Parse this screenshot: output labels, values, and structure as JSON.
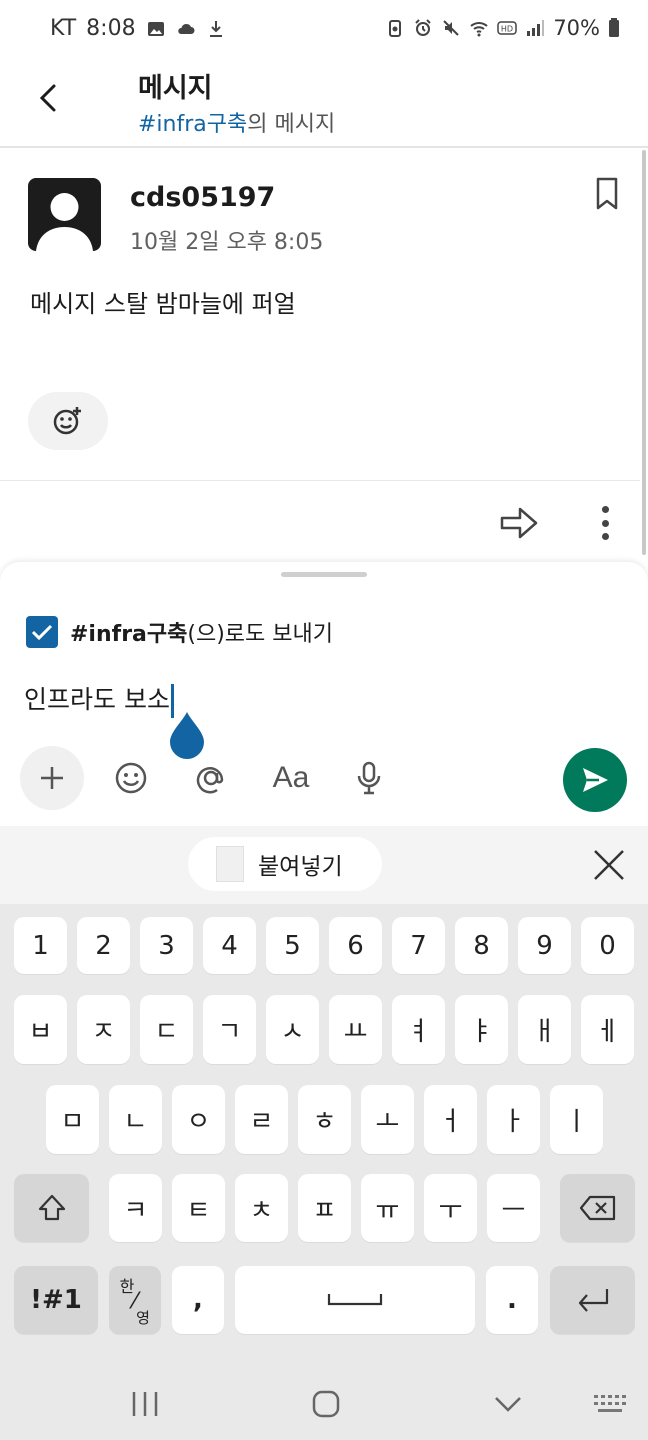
{
  "status_bar": {
    "carrier": "KT",
    "time": "8:08",
    "battery": "70%"
  },
  "header": {
    "title": "메시지",
    "channel": "#infra구축",
    "subtitle_suffix": "의 메시지"
  },
  "message": {
    "author": "cds05197",
    "timestamp": "10월 2일 오후 8:05",
    "text": "메시지 스탈 밤마늘에 퍼얼"
  },
  "composer": {
    "also_send_channel": "#infra구축",
    "also_send_suffix": "(으)로도 보내기",
    "also_send_checked": true,
    "draft_text": "인프라도 보소",
    "format_label": "Aa"
  },
  "keyboard": {
    "paste_label": "붙여넣기",
    "row_numbers": [
      "1",
      "2",
      "3",
      "4",
      "5",
      "6",
      "7",
      "8",
      "9",
      "0"
    ],
    "row1": [
      "ㅂ",
      "ㅈ",
      "ㄷ",
      "ㄱ",
      "ㅅ",
      "ㅛ",
      "ㅕ",
      "ㅑ",
      "ㅐ",
      "ㅔ"
    ],
    "row2": [
      "ㅁ",
      "ㄴ",
      "ㅇ",
      "ㄹ",
      "ㅎ",
      "ㅗ",
      "ㅓ",
      "ㅏ",
      "ㅣ"
    ],
    "row3": [
      "ㅋ",
      "ㅌ",
      "ㅊ",
      "ㅍ",
      "ㅠ",
      "ㅜ",
      "ㅡ"
    ],
    "symbols_label": "!#1",
    "lang_top": "한",
    "lang_bottom": "영",
    "comma": ",",
    "period": "."
  },
  "colors": {
    "accent": "#1264a3",
    "send": "#007a5a"
  }
}
